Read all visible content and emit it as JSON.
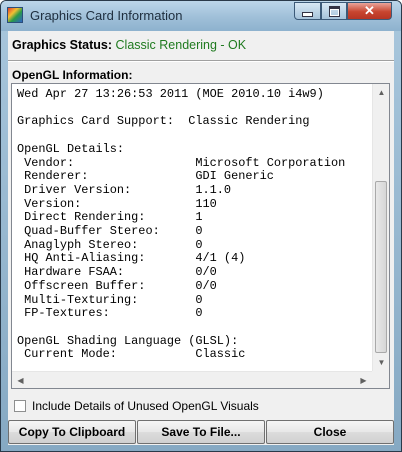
{
  "window": {
    "title": "Graphics Card Information",
    "controls": {
      "minimize": "minimize",
      "maximize": "maximize",
      "close": "close"
    }
  },
  "status": {
    "label": "Graphics Status:",
    "value": "Classic Rendering - OK",
    "value_color": "#1f7a1f"
  },
  "section_title": "OpenGL Information:",
  "info_lines": [
    "Wed Apr 27 13:26:53 2011 (MOE 2010.10 i4w9)",
    "",
    "Graphics Card Support:  Classic Rendering",
    "",
    "OpenGL Details:",
    " Vendor:                 Microsoft Corporation",
    " Renderer:               GDI Generic",
    " Driver Version:         1.1.0",
    " Version:                110",
    " Direct Rendering:       1",
    " Quad-Buffer Stereo:     0",
    " Anaglyph Stereo:        0",
    " HQ Anti-Aliasing:       4/1 (4)",
    " Hardware FSAA:          0/0",
    " Offscreen Buffer:       0/0",
    " Multi-Texturing:        0",
    " FP-Textures:            0",
    "",
    "OpenGL Shading Language (GLSL):",
    " Current Mode:           Classic"
  ],
  "checkbox": {
    "label": "Include Details of Unused OpenGL Visuals",
    "checked": false
  },
  "buttons": {
    "copy": "Copy To Clipboard",
    "save": "Save To File...",
    "close": "Close"
  },
  "scrollbar": {
    "vertical_position": 0.0
  }
}
